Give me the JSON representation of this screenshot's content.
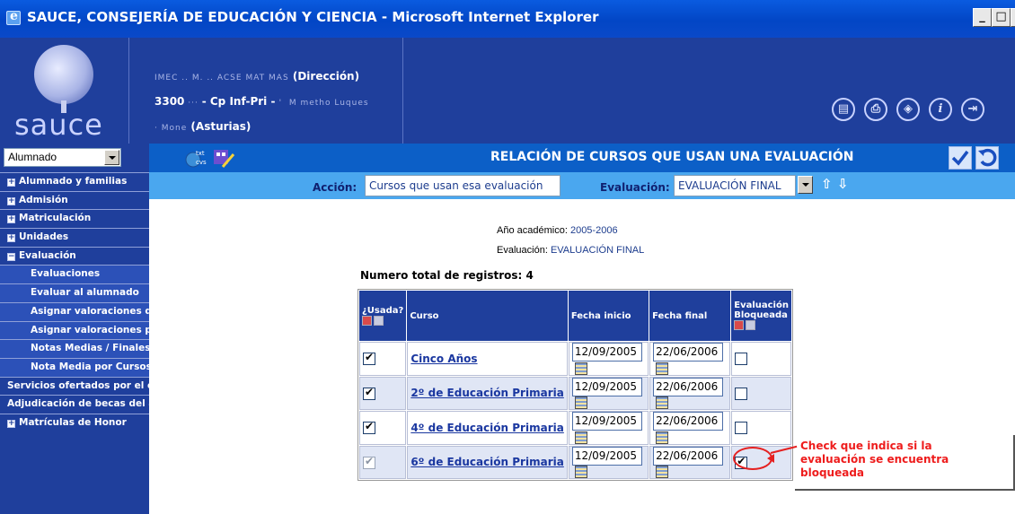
{
  "window": {
    "title": "SAUCE, CONSEJERÍA DE EDUCACIÓN Y CIENCIA - Microsoft Internet Explorer",
    "buttons": [
      "_",
      "□",
      "×"
    ]
  },
  "header": {
    "logo_text": "sauce",
    "school": {
      "line1_blurred": "IMEC .. M. .. ACSE MAT MAS",
      "line1": "(Dirección)",
      "line2_prefix": "3300",
      "line2": "- Cp Inf-Pri -",
      "line2_blurred": "'  M metho Luques",
      "line3_blurred": "· Mone",
      "line3": "(Asturias)"
    },
    "icons": [
      "document-icon",
      "printer-icon",
      "navigation-icon",
      "info-icon",
      "exit-icon"
    ]
  },
  "sidebar": {
    "profile_select": "Alumnado",
    "menu": [
      {
        "label": "Alumnado y familias",
        "type": "collapsed"
      },
      {
        "label": "Admisión",
        "type": "collapsed"
      },
      {
        "label": "Matriculación",
        "type": "collapsed"
      },
      {
        "label": "Unidades",
        "type": "collapsed"
      },
      {
        "label": "Evaluación",
        "type": "expanded"
      },
      {
        "label": "Evaluaciones",
        "type": "sub"
      },
      {
        "label": "Evaluar al alumnado",
        "type": "sub"
      },
      {
        "label": "Asignar valoraciones de",
        "type": "sub"
      },
      {
        "label": "Asignar valoraciones por",
        "type": "sub"
      },
      {
        "label": "Notas Medias / Finales",
        "type": "sub"
      },
      {
        "label": "Nota Media por Cursos",
        "type": "sub"
      },
      {
        "label": "Servicios ofertados por el ce",
        "type": "flat"
      },
      {
        "label": "Adjudicación de becas del alu",
        "type": "flat"
      },
      {
        "label": "Matrículas de Honor",
        "type": "collapsed"
      }
    ]
  },
  "toolbar": {
    "title": "RELACIÓN DE CURSOS QUE USAN UNA EVALUACIÓN",
    "left_icons": [
      "export-csv-icon",
      "edit-icon"
    ],
    "right_icons": [
      "accept-icon",
      "back-icon"
    ]
  },
  "filters": {
    "accion_label": "Acción:",
    "accion_value": "Cursos que usan esa evaluación",
    "evaluacion_label": "Evaluación:",
    "evaluacion_value": "EVALUACIÓN FINAL",
    "sort_up": "⇧",
    "sort_down": "⇩"
  },
  "info": {
    "year_label": "Año académico:",
    "year_value": "2005-2006",
    "eval_label": "Evaluación:",
    "eval_value": "EVALUACIÓN FINAL",
    "total": "Numero total de registros: 4"
  },
  "table": {
    "headers": {
      "usada": "¿Usada?",
      "curso": "Curso",
      "fecha_inicio": "Fecha inicio",
      "fecha_final": "Fecha final",
      "bloqueada": "Evaluación Bloqueada"
    },
    "rows": [
      {
        "usada": true,
        "usada_disabled": false,
        "curso": "Cinco Años",
        "inicio": "12/09/2005",
        "final": "22/06/2006",
        "bloqueada": false
      },
      {
        "usada": true,
        "usada_disabled": false,
        "curso": "2º de Educación Primaria",
        "inicio": "12/09/2005",
        "final": "22/06/2006",
        "bloqueada": false
      },
      {
        "usada": true,
        "usada_disabled": false,
        "curso": "4º de Educación Primaria",
        "inicio": "12/09/2005",
        "final": "22/06/2006",
        "bloqueada": false
      },
      {
        "usada": true,
        "usada_disabled": true,
        "curso": "6º de Educación Primaria",
        "inicio": "12/09/2005",
        "final": "22/06/2006",
        "bloqueada": true
      }
    ]
  },
  "annotation": {
    "line1": "Check que indica si la",
    "line2": "evaluación se encuentra",
    "line3": "bloqueada",
    "color": "#ee1c1c"
  }
}
